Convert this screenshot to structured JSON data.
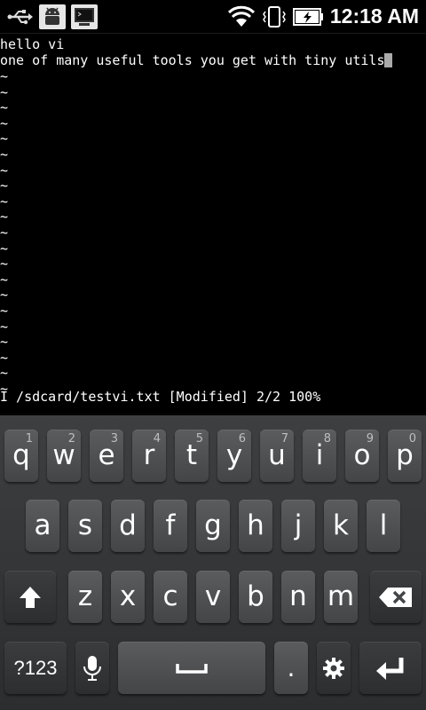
{
  "status_bar": {
    "icons": [
      "usb-icon",
      "android-debug-icon",
      "terminal-icon",
      "wifi-icon",
      "vibrate-icon",
      "battery-charging-icon"
    ],
    "time": "12:18 AM"
  },
  "editor": {
    "lines": [
      "hello vi",
      "one of many useful tools you get with tiny utils"
    ],
    "tildes": [
      "~",
      "~",
      "~",
      "~",
      "~",
      "~",
      "~",
      "~",
      "~",
      "~",
      "~",
      "~",
      "~",
      "~",
      "~",
      "~",
      "~",
      "~",
      "~",
      "~",
      "~"
    ],
    "status_line": "I /sdcard/testvi.txt [Modified] 2/2 100%"
  },
  "keyboard": {
    "row1": [
      {
        "label": "q",
        "hint": "1"
      },
      {
        "label": "w",
        "hint": "2"
      },
      {
        "label": "e",
        "hint": "3"
      },
      {
        "label": "r",
        "hint": "4"
      },
      {
        "label": "t",
        "hint": "5"
      },
      {
        "label": "y",
        "hint": "6"
      },
      {
        "label": "u",
        "hint": "7"
      },
      {
        "label": "i",
        "hint": "8"
      },
      {
        "label": "o",
        "hint": "9"
      },
      {
        "label": "p",
        "hint": "0"
      }
    ],
    "row2": [
      "a",
      "s",
      "d",
      "f",
      "g",
      "h",
      "j",
      "k",
      "l"
    ],
    "row3": [
      "z",
      "x",
      "c",
      "v",
      "b",
      "n",
      "m"
    ],
    "row4": {
      "symbols": "?123",
      "period": "."
    }
  }
}
